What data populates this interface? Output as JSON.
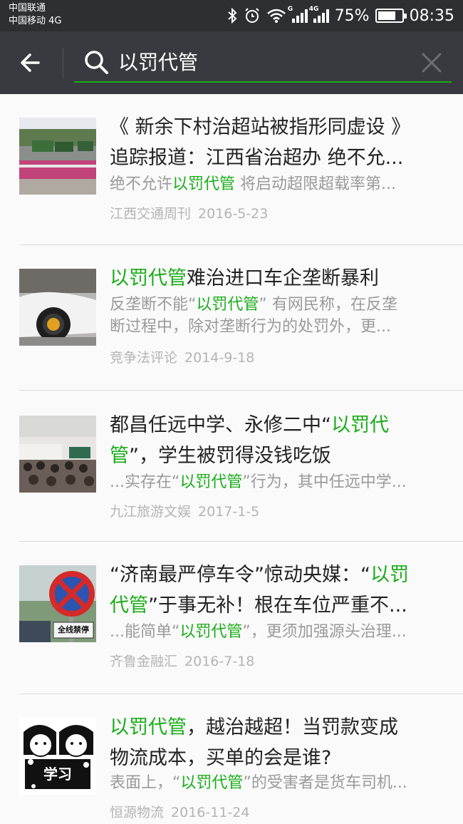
{
  "status_bar": {
    "carrier_1": "中国联通",
    "carrier_2": "中国移动 4G",
    "network_tag_1": "G",
    "network_tag_2": "4G",
    "battery_percent": "75%",
    "battery_level": 0.75,
    "time": "08:35"
  },
  "search": {
    "query": "以罚代管"
  },
  "results": [
    {
      "title_lines": [
        [
          {
            "t": "《 新余下村治超站被指形同虚设 》",
            "hl": false
          }
        ],
        [
          {
            "t": "追踪报道：江西省治超办 绝不允...",
            "hl": false
          }
        ]
      ],
      "desc_lines": [
        [
          {
            "t": "绝不允许",
            "hl": false
          },
          {
            "t": "以罚代管",
            "hl": true
          },
          {
            "t": " 将启动超限超载率第...",
            "hl": false
          }
        ]
      ],
      "source": "江西交通周刊",
      "date": "2016-5-23",
      "thumbnail": "trucks-road-photo"
    },
    {
      "title_lines": [
        [
          {
            "t": "以罚代管",
            "hl": true
          },
          {
            "t": "难治进口车企垄断暴利",
            "hl": false
          }
        ]
      ],
      "desc_lines": [
        [
          {
            "t": "反垄断不能“",
            "hl": false
          },
          {
            "t": "以罚代管",
            "hl": true
          },
          {
            "t": "” 有网民称，在反垄",
            "hl": false
          }
        ],
        [
          {
            "t": "断过程中，除对垄断行为的处罚外，更...",
            "hl": false
          }
        ]
      ],
      "source": "竞争法评论",
      "date": "2014-9-18",
      "thumbnail": "white-car-photo"
    },
    {
      "title_lines": [
        [
          {
            "t": "都昌任远中学、永修二中“",
            "hl": false
          },
          {
            "t": "以罚代",
            "hl": true
          }
        ],
        [
          {
            "t": "管",
            "hl": true
          },
          {
            "t": "”，学生被罚得没钱吃饭",
            "hl": false
          }
        ]
      ],
      "desc_lines": [
        [
          {
            "t": "...实存在“",
            "hl": false
          },
          {
            "t": "以罚代管",
            "hl": true
          },
          {
            "t": "”行为，其中任远中学...",
            "hl": false
          }
        ]
      ],
      "source": "九江旅游文娱",
      "date": "2017-1-5",
      "thumbnail": "classroom-photo"
    },
    {
      "title_lines": [
        [
          {
            "t": "“济南最严停车令”惊动央媒：“",
            "hl": false
          },
          {
            "t": "以罚",
            "hl": true
          }
        ],
        [
          {
            "t": "代管",
            "hl": true
          },
          {
            "t": "”于事无补！根在车位严重不...",
            "hl": false
          }
        ]
      ],
      "desc_lines": [
        [
          {
            "t": "...能简单“",
            "hl": false
          },
          {
            "t": "以罚代管",
            "hl": true
          },
          {
            "t": "”，更须加强源头治理...",
            "hl": false
          }
        ]
      ],
      "source": "齐鲁金融汇",
      "date": "2016-7-18",
      "thumbnail": "no-parking-sign-photo",
      "thumbnail_sign_text": "全线禁停"
    },
    {
      "title_lines": [
        [
          {
            "t": "以罚代管",
            "hl": true
          },
          {
            "t": "，越治越超！当罚款变成",
            "hl": false
          }
        ],
        [
          {
            "t": "物流成本，买单的会是谁?",
            "hl": false
          }
        ]
      ],
      "desc_lines": [
        [
          {
            "t": "表面上，“",
            "hl": false
          },
          {
            "t": "以罚代管",
            "hl": true
          },
          {
            "t": "”的受害者是货车司机...",
            "hl": false
          }
        ]
      ],
      "source": "恒源物流",
      "date": "2016-11-24",
      "thumbnail": "cartoon-students-drawing",
      "thumbnail_caption": "学习"
    }
  ]
}
